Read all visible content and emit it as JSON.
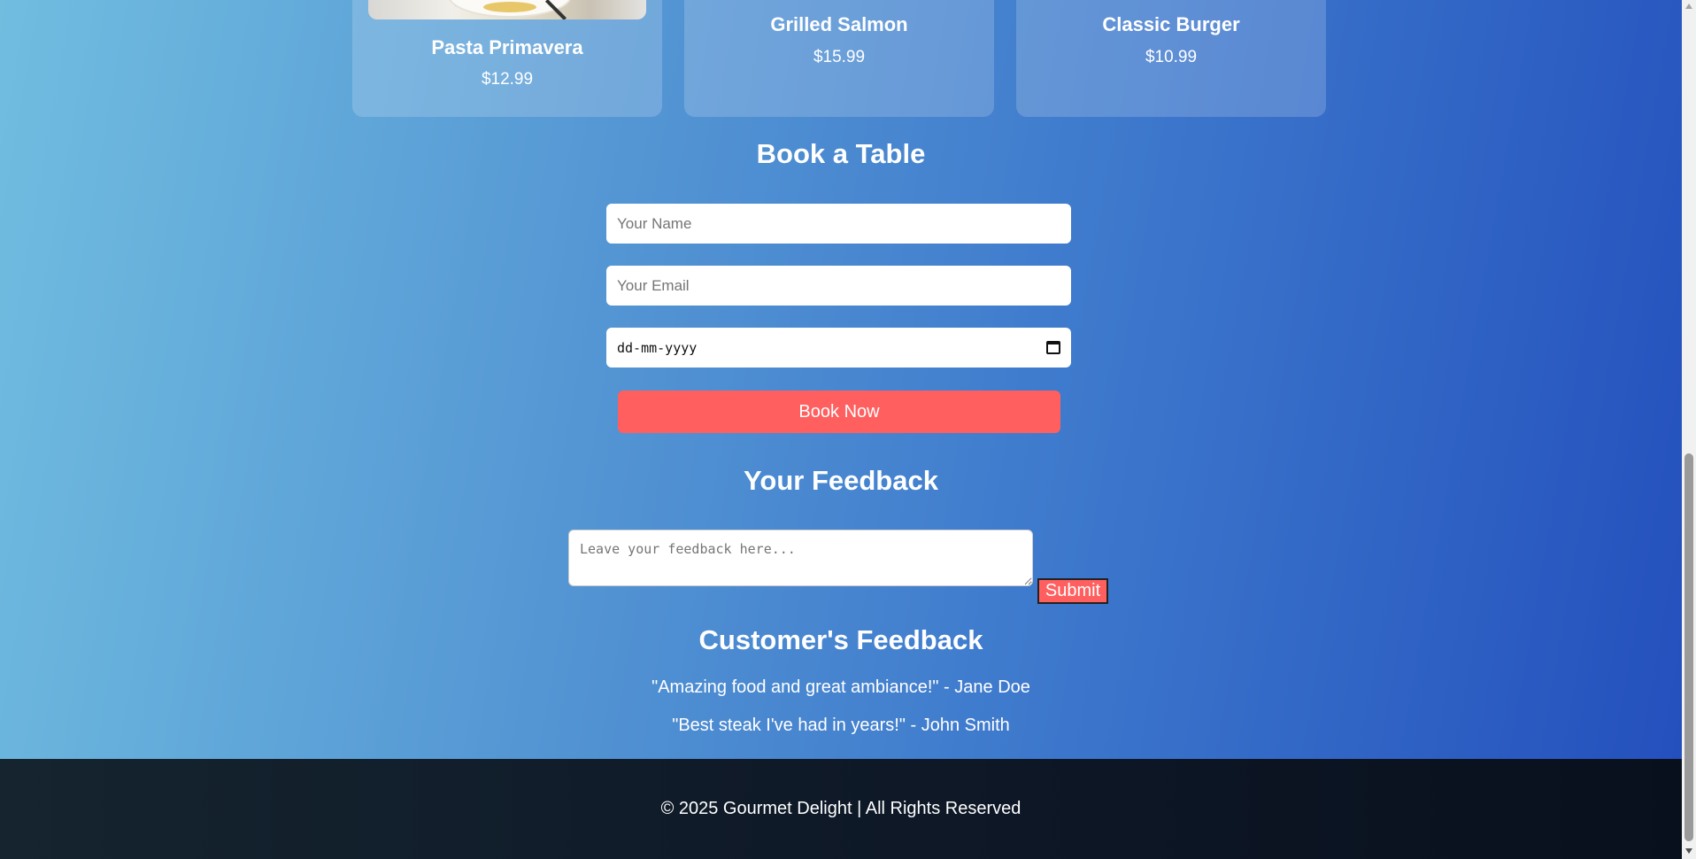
{
  "menu": {
    "items": [
      {
        "name": "Pasta Primavera",
        "price": "$12.99"
      },
      {
        "name": "Grilled Salmon",
        "price": "$15.99"
      },
      {
        "name": "Classic Burger",
        "price": "$10.99"
      }
    ]
  },
  "booking": {
    "title": "Book a Table",
    "name_placeholder": "Your Name",
    "email_placeholder": "Your Email",
    "date_placeholder": "dd-mm-yyyy",
    "button_label": "Book Now"
  },
  "feedback": {
    "title": "Your Feedback",
    "textarea_placeholder": "Leave your feedback here...",
    "submit_label": "Submit"
  },
  "testimonials": {
    "title": "Customer's Feedback",
    "quotes": [
      "\"Amazing food and great ambiance!\" - Jane Doe",
      "\"Best steak I've had in years!\" - John Smith"
    ]
  },
  "footer": {
    "text": "© 2025 Gourmet Delight | All Rights Reserved"
  },
  "colors": {
    "accent": "#ff5f5f",
    "gradient_start": "#70bde0",
    "gradient_end": "#2450bd",
    "footer_bg": "#0e1827"
  }
}
